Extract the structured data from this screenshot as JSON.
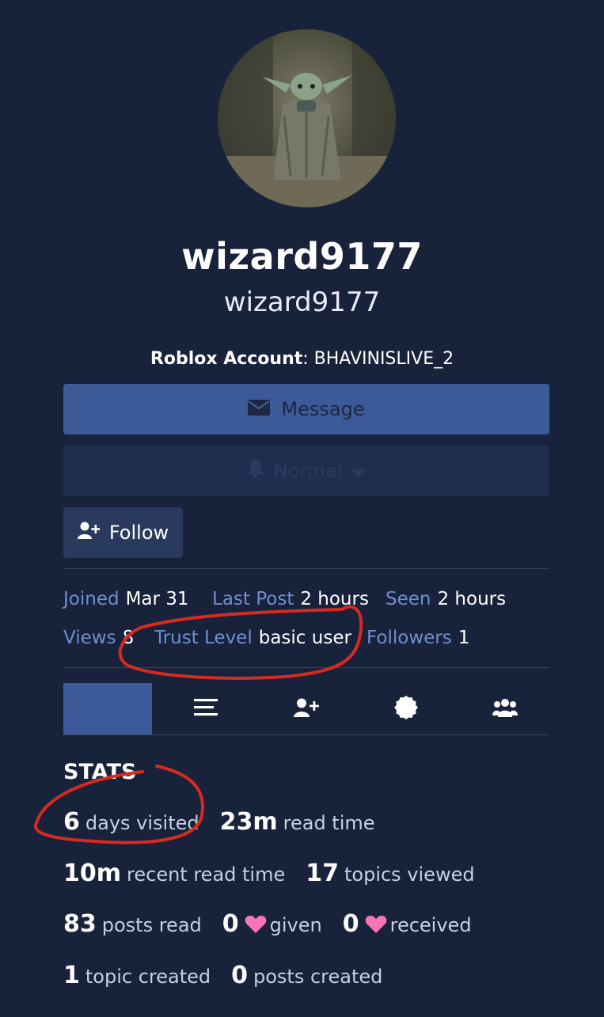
{
  "profile": {
    "display_name": "wizard9177",
    "username": "wizard9177",
    "roblox_key": "Roblox Account",
    "roblox_sep": ": ",
    "roblox_value": "BHAVINISLIVE_2"
  },
  "actions": {
    "message_label": "Message",
    "notification_label": "Normal",
    "follow_label": "Follow"
  },
  "meta": {
    "joined_key": "Joined",
    "joined_value": "Mar 31",
    "last_post_key": "Last Post",
    "last_post_value": "2 hours",
    "seen_key": "Seen",
    "seen_value": "2 hours",
    "views_key": "Views",
    "views_value": "8",
    "trust_level_key": "Trust Level",
    "trust_level_value": "basic user",
    "followers_key": "Followers",
    "followers_value": "1"
  },
  "tabs": [
    {
      "icon": "summary",
      "active": true
    },
    {
      "icon": "list-icon",
      "active": false
    },
    {
      "icon": "user-plus-icon",
      "active": false
    },
    {
      "icon": "badge-icon",
      "active": false
    },
    {
      "icon": "users-icon",
      "active": false
    }
  ],
  "stats": {
    "title": "STATS",
    "days_visited_num": "6",
    "days_visited_label": "days visited",
    "read_time_num": "23m",
    "read_time_label": "read time",
    "recent_read_time_num": "10m",
    "recent_read_time_label": "recent read time",
    "topics_viewed_num": "17",
    "topics_viewed_label": "topics viewed",
    "posts_read_num": "83",
    "posts_read_label": "posts read",
    "likes_given_num": "0",
    "likes_given_label": "given",
    "likes_received_num": "0",
    "likes_received_label": "received",
    "topic_created_num": "1",
    "topic_created_label": "topic created",
    "posts_created_num": "0",
    "posts_created_label": "posts created"
  },
  "colors": {
    "background": "#18223a",
    "accent": "#3d5a98",
    "meta_key": "#6f8fce",
    "heart": "#f774b7",
    "annotation": "#d62b1e"
  }
}
